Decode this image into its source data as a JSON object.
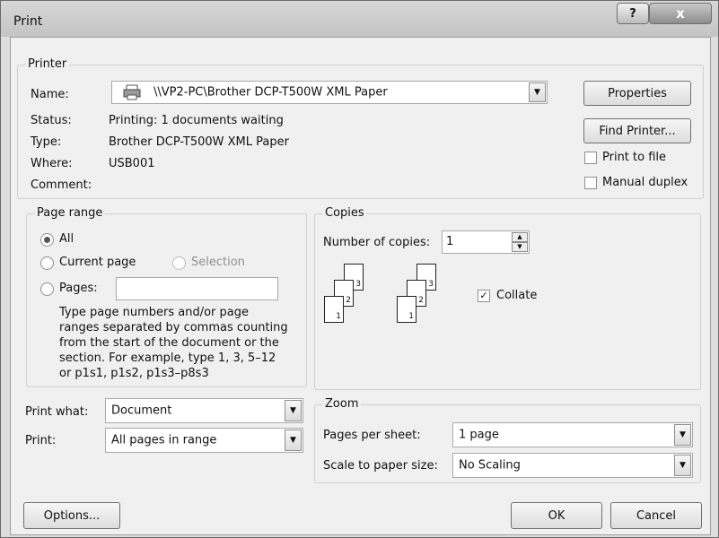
{
  "window": {
    "title": "Print",
    "help_label": "?",
    "close_label": "x"
  },
  "printer": {
    "legend": "Printer",
    "name_label": "Name:",
    "name_value": "\\\\VP2-PC\\Brother DCP-T500W XML Paper",
    "status_label": "Status:",
    "status_value": "Printing: 1 documents waiting",
    "type_label": "Type:",
    "type_value": "Brother DCP-T500W XML Paper",
    "where_label": "Where:",
    "where_value": "USB001",
    "comment_label": "Comment:",
    "properties_button": "Properties",
    "find_printer_button": "Find Printer...",
    "print_to_file_label": "Print to file",
    "print_to_file_checked": false,
    "manual_duplex_label": "Manual duplex",
    "manual_duplex_checked": false,
    "icon": "printer-icon"
  },
  "page_range": {
    "legend": "Page range",
    "all_label": "All",
    "current_page_label": "Current page",
    "selection_label": "Selection",
    "pages_label": "Pages:",
    "pages_value": "",
    "selected": "All",
    "help_lines": [
      "Type page numbers and/or page",
      "ranges separated by commas counting",
      "from the start of the document or the",
      "section. For example, type 1, 3, 5–12",
      "or p1s1, p1s2, p1s3–p8s3"
    ]
  },
  "copies": {
    "legend": "Copies",
    "number_label": "Number of copies:",
    "number_value": "1",
    "collate_label": "Collate",
    "collate_checked": true,
    "page_numbers": [
      "1",
      "2",
      "3"
    ]
  },
  "print_what": {
    "label": "Print what:",
    "value": "Document"
  },
  "print": {
    "label": "Print:",
    "value": "All pages in range"
  },
  "zoom": {
    "legend": "Zoom",
    "pages_per_sheet_label": "Pages per sheet:",
    "pages_per_sheet_value": "1 page",
    "scale_label": "Scale to paper size:",
    "scale_value": "No Scaling"
  },
  "footer": {
    "options_button": "Options...",
    "ok_button": "OK",
    "cancel_button": "Cancel"
  }
}
